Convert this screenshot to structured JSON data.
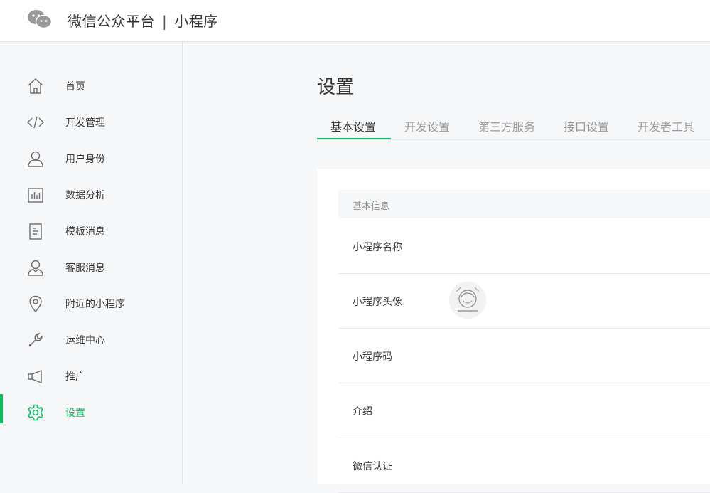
{
  "header": {
    "brand_left": "微信公众平台",
    "separator": "|",
    "brand_right": "小程序",
    "logo_icon": "wechat-logo-icon"
  },
  "sidebar": {
    "items": [
      {
        "label": "首页",
        "icon": "home-icon"
      },
      {
        "label": "开发管理",
        "icon": "code-icon"
      },
      {
        "label": "用户身份",
        "icon": "user-icon"
      },
      {
        "label": "数据分析",
        "icon": "bar-chart-icon"
      },
      {
        "label": "模板消息",
        "icon": "document-icon"
      },
      {
        "label": "客服消息",
        "icon": "customer-service-icon"
      },
      {
        "label": "附近的小程序",
        "icon": "location-pin-icon"
      },
      {
        "label": "运维中心",
        "icon": "wrench-icon"
      },
      {
        "label": "推广",
        "icon": "megaphone-icon"
      },
      {
        "label": "设置",
        "icon": "gear-icon",
        "active": true
      }
    ]
  },
  "main": {
    "title": "设置",
    "tabs": [
      {
        "label": "基本设置",
        "active": true
      },
      {
        "label": "开发设置"
      },
      {
        "label": "第三方服务"
      },
      {
        "label": "接口设置"
      },
      {
        "label": "开发者工具"
      }
    ],
    "section_title": "基本信息",
    "rows": [
      {
        "label": "小程序名称"
      },
      {
        "label": "小程序头像"
      },
      {
        "label": "小程序码"
      },
      {
        "label": "介绍"
      },
      {
        "label": "微信认证"
      }
    ]
  },
  "colors": {
    "accent": "#07c160",
    "text": "#353535",
    "muted": "#9a9a9a",
    "background": "#f6f7f9"
  }
}
